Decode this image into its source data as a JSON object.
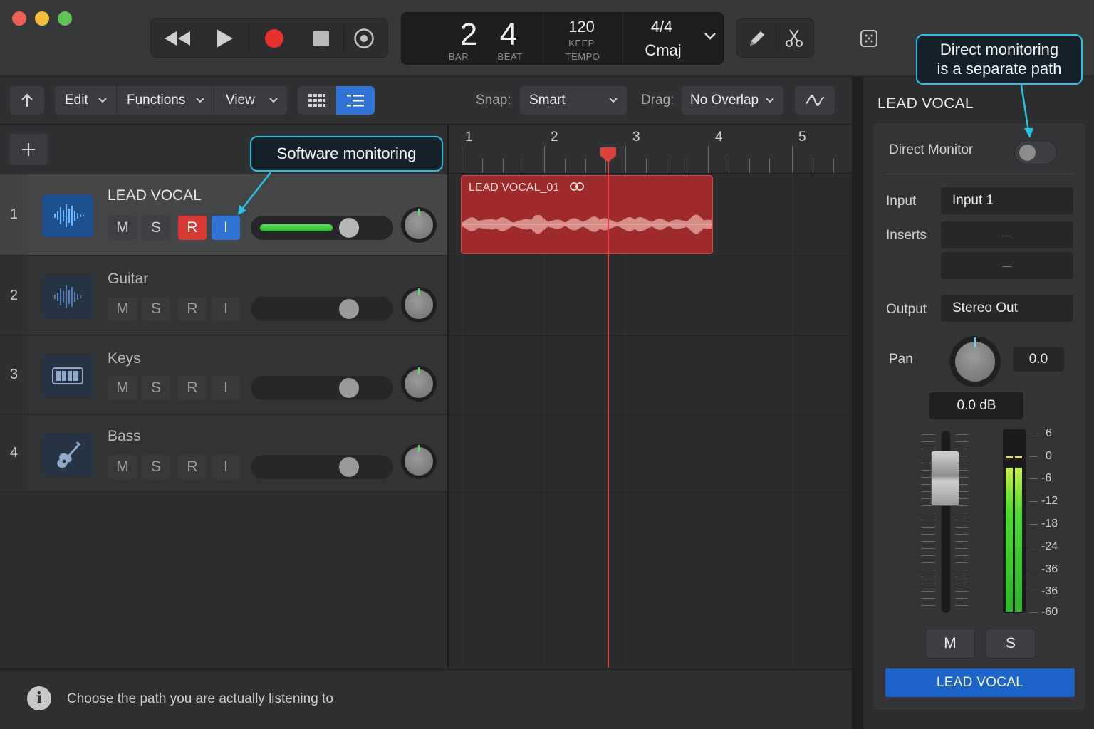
{
  "transport": {
    "bar_value": "2",
    "bar_label": "BAR",
    "beat_value": "4",
    "beat_label": "BEAT",
    "tempo_value": "120",
    "tempo_mode": "KEEP",
    "tempo_label": "TEMPO",
    "signature": "4/4",
    "key": "Cmaj"
  },
  "toolbar": {
    "edit_label": "Edit",
    "functions_label": "Functions",
    "view_label": "View",
    "snap_label": "Snap:",
    "snap_value": "Smart",
    "drag_label": "Drag:",
    "drag_value": "No Overlap"
  },
  "tracks": [
    {
      "number": "1",
      "name": "LEAD VOCAL",
      "icon": "waveform-icon",
      "mute": "M",
      "solo": "S",
      "record": "R",
      "input": "I",
      "volume": 0.75,
      "record_armed": true,
      "input_monitoring": true
    },
    {
      "number": "2",
      "name": "Guitar",
      "icon": "waveform-icon",
      "mute": "M",
      "solo": "S",
      "record": "R",
      "input": "I",
      "volume": 0.75
    },
    {
      "number": "3",
      "name": "Keys",
      "icon": "keyboard-icon",
      "mute": "M",
      "solo": "S",
      "record": "R",
      "input": "I",
      "volume": 0.75
    },
    {
      "number": "4",
      "name": "Bass",
      "icon": "guitar-icon",
      "mute": "M",
      "solo": "S",
      "record": "R",
      "input": "I",
      "volume": 0.75
    }
  ],
  "ruler": {
    "bars": [
      "1",
      "2",
      "3",
      "4",
      "5"
    ],
    "playhead": "2 4"
  },
  "region": {
    "name": "LEAD VOCAL_01",
    "loop_icon": "link-icon"
  },
  "callouts": {
    "software": "Software monitoring",
    "direct_line1": "Direct monitoring",
    "direct_line2": "is a separate path"
  },
  "inspector": {
    "title": "LEAD VOCAL",
    "direct_monitor_label": "Direct Monitor",
    "direct_monitor_on": false,
    "input_label": "Input",
    "input_value": "Input 1",
    "inserts_label": "Inserts",
    "insert_slot_1": "—",
    "insert_slot_2": "—",
    "output_label": "Output",
    "output_value": "Stereo Out",
    "pan_label": "Pan",
    "pan_value": "0.0",
    "gain_value": "0.0 dB",
    "db_scale": [
      "6",
      "0",
      "-6",
      "-12",
      "-18",
      "-24",
      "-36",
      "-36",
      "-60"
    ],
    "mute": "M",
    "solo": "S",
    "channel_name": "LEAD VOCAL"
  },
  "status": {
    "text": "Choose the path you are actually listening to",
    "icon": "info-icon"
  },
  "colors": {
    "accent": "#2f74d6",
    "record": "#d73a32",
    "region": "#9e2a2a",
    "callout": "#27c2e6",
    "meter": "#4fdb2e"
  }
}
